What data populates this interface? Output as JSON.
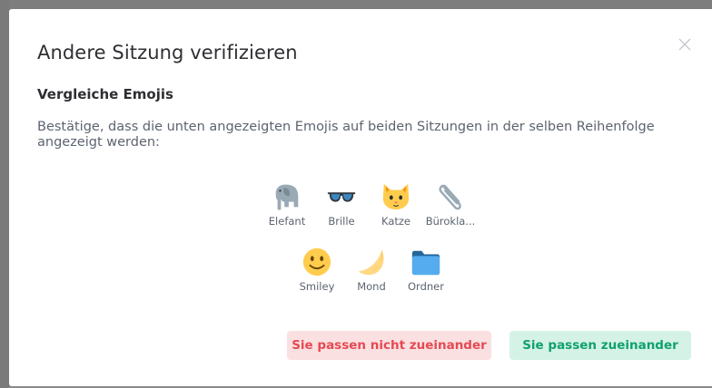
{
  "dialog": {
    "title": "Andere Sitzung verifizieren",
    "heading": "Vergleiche Emojis",
    "description": "Bestätige, dass die unten angezeigten Emojis auf beiden Sitzungen in der selben Reihenfolge angezeigt werden:",
    "emojis": [
      {
        "label": "Elefant",
        "icon": "elephant-icon"
      },
      {
        "label": "Brille",
        "icon": "glasses-icon"
      },
      {
        "label": "Katze",
        "icon": "cat-icon"
      },
      {
        "label": "Bürokla...",
        "icon": "paperclip-icon"
      },
      {
        "label": "Smiley",
        "icon": "smiley-icon"
      },
      {
        "label": "Mond",
        "icon": "moon-icon"
      },
      {
        "label": "Ordner",
        "icon": "folder-icon"
      }
    ],
    "buttons": {
      "mismatch": "Sie passen nicht zueinander",
      "match": "Sie passen zueinander"
    },
    "close_icon": "close-icon"
  },
  "colors": {
    "mismatch_text": "#e44a52",
    "mismatch_bg": "#fbe0e1",
    "match_text": "#0fa16e",
    "match_bg": "#d5f2e7"
  }
}
